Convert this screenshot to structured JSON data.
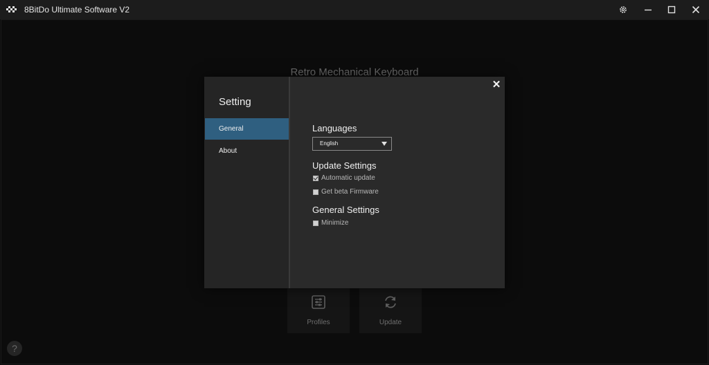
{
  "window": {
    "title": "8BitDo Ultimate Software V2",
    "controls": [
      "gear-icon",
      "minimize-icon",
      "maximize-icon",
      "close-icon"
    ]
  },
  "background": {
    "device_name": "Retro Mechanical Keyboard",
    "tiles": [
      {
        "label": "Profiles",
        "icon": "sliders-icon"
      },
      {
        "label": "Update",
        "icon": "refresh-icon"
      }
    ],
    "help_label": "?"
  },
  "dialog": {
    "title": "Setting",
    "nav": [
      {
        "label": "General",
        "active": true
      },
      {
        "label": "About",
        "active": false
      }
    ],
    "close_label": "✕",
    "languages": {
      "title": "Languages",
      "selected": "English"
    },
    "update_settings": {
      "title": "Update Settings",
      "options": [
        {
          "label": "Automatic update",
          "checked": true
        },
        {
          "label": "Get beta Firmware",
          "checked": false
        }
      ]
    },
    "general_settings": {
      "title": "General Settings",
      "options": [
        {
          "label": "Minimize",
          "checked": false
        }
      ]
    }
  },
  "colors": {
    "accent": "#2f5f80",
    "dialog_bg": "#2a2a2a",
    "sidebar_bg": "#252525"
  }
}
